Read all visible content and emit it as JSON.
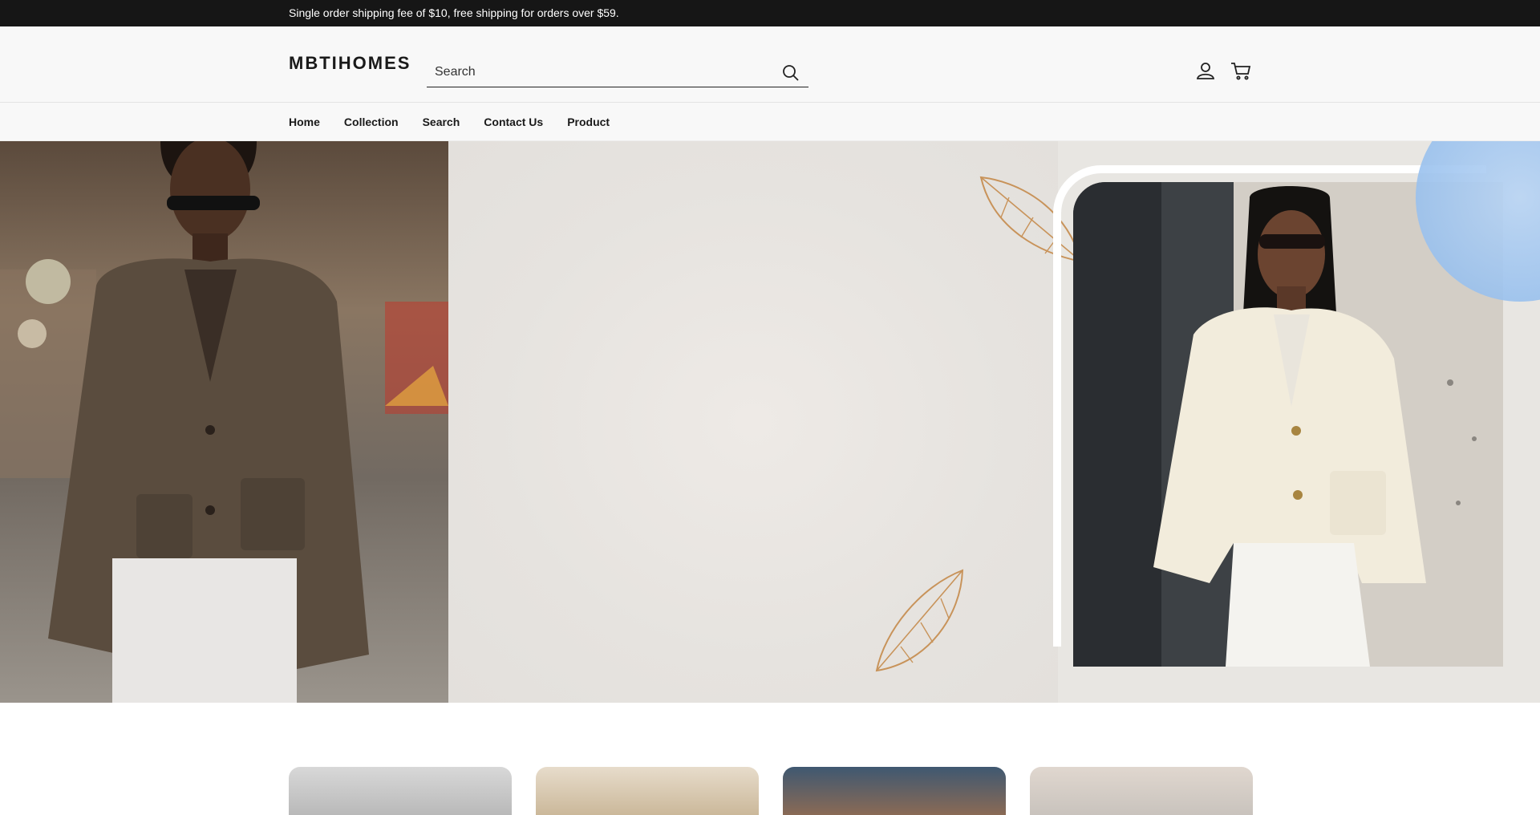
{
  "announcement": {
    "text": "Single order shipping fee of $10, free shipping for orders over $59."
  },
  "header": {
    "logo": "MBTIHOMES",
    "search": {
      "placeholder": "Search",
      "value": ""
    },
    "icons": [
      "search-icon",
      "account-icon",
      "cart-icon"
    ]
  },
  "nav": {
    "items": [
      {
        "label": "Home"
      },
      {
        "label": "Collection"
      },
      {
        "label": "Search"
      },
      {
        "label": "Contact Us"
      },
      {
        "label": "Product"
      }
    ]
  },
  "colors": {
    "announcement_bg": "#161616",
    "header_bg": "#f8f8f8",
    "hero_bg": "#e8e6e2",
    "accent_leaf": "#c8935a",
    "accent_circle": "#9ec4ef"
  },
  "product_cards": [
    {
      "name": "product-card-1"
    },
    {
      "name": "product-card-2"
    },
    {
      "name": "product-card-3"
    },
    {
      "name": "product-card-4"
    }
  ]
}
